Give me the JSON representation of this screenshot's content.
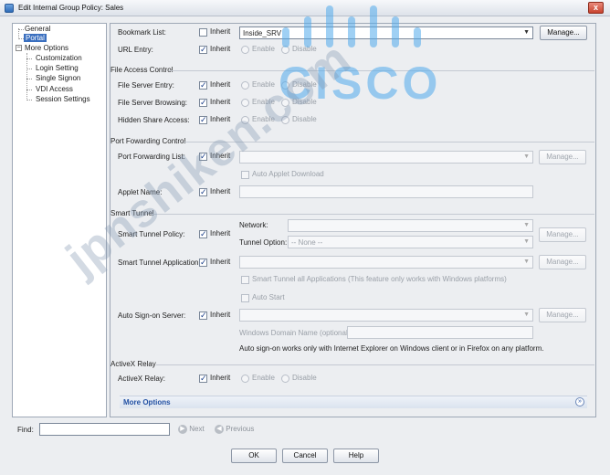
{
  "window": {
    "title": "Edit Internal Group Policy: Sales",
    "close_glyph": "x"
  },
  "tree": {
    "items": [
      {
        "label": "General"
      },
      {
        "label": "Portal",
        "selected": true
      },
      {
        "label": "More Options",
        "expanded": true
      },
      {
        "label": "Customization"
      },
      {
        "label": "Login Setting"
      },
      {
        "label": "Single Signon"
      },
      {
        "label": "VDI Access"
      },
      {
        "label": "Session Settings"
      }
    ]
  },
  "portal": {
    "inherit": "Inherit",
    "enable": "Enable",
    "disable": "Disable",
    "bookmark": {
      "label": "Bookmark List:",
      "value": "Inside_SRV",
      "manage": "Manage..."
    },
    "url_entry": {
      "label": "URL Entry:"
    },
    "file_access": {
      "title": "File Access Control",
      "server_entry": "File Server Entry:",
      "server_browsing": "File Server Browsing:",
      "hidden_share": "Hidden Share Access:"
    },
    "port_forwarding": {
      "title": "Port Fowarding Control",
      "list_label": "Port Forwarding List:",
      "manage": "Manage...",
      "auto_applet": "Auto Applet Download",
      "applet_name": "Applet Name:"
    },
    "smart_tunnel": {
      "title": "Smart Tunnel",
      "policy_label": "Smart Tunnel Policy:",
      "network_label": "Network:",
      "tunnel_option_label": "Tunnel Option:",
      "tunnel_option_value": "-- None --",
      "manage": "Manage...",
      "application_label": "Smart Tunnel Application:",
      "all_apps": "Smart Tunnel all Applications (This feature only works with Windows platforms)",
      "auto_start": "Auto Start",
      "sign_on_label": "Auto Sign-on Server:",
      "domain_label": "Windows Domain Name (optional):",
      "note": "Auto sign-on works only with Internet Explorer on Windows client or in Firefox on any platform."
    },
    "activex": {
      "title": "ActiveX Relay",
      "label": "ActiveX Relay:"
    },
    "more_options": "More Options",
    "more_options_icon": "double-chevron-down-icon"
  },
  "find": {
    "label": "Find:",
    "value": "",
    "next": "Next",
    "previous": "Previous"
  },
  "buttons": {
    "ok": "OK",
    "cancel": "Cancel",
    "help": "Help"
  },
  "watermark": {
    "text": "jpnshiken.com",
    "logo_word": "CISCO"
  }
}
